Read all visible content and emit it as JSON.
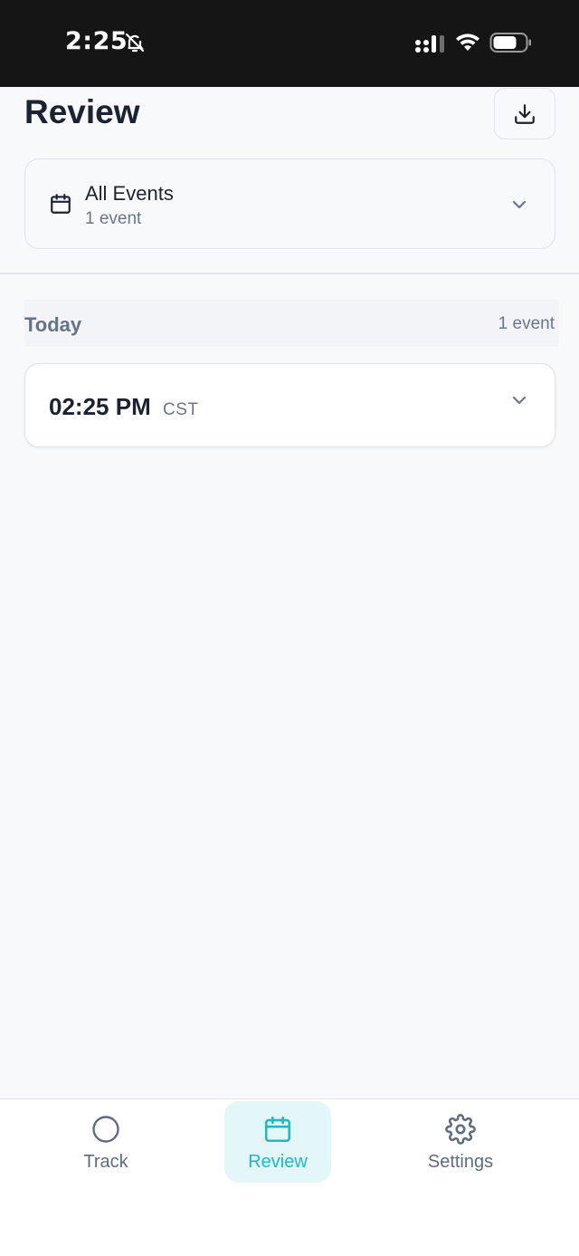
{
  "status_bar": {
    "time": "2:25",
    "icons": [
      "bell-slash-icon",
      "cellular-signal-icon",
      "wifi-icon",
      "battery-icon"
    ]
  },
  "header": {
    "title": "Review",
    "download_icon": "download-icon"
  },
  "filter": {
    "icon": "calendar-icon",
    "title": "All Events",
    "subtitle": "1 event",
    "chevron": "chevron-down-icon"
  },
  "section": {
    "title": "Today",
    "count": "1 event"
  },
  "events": [
    {
      "time": "02:25 PM",
      "timezone": "CST"
    }
  ],
  "nav": {
    "items": [
      {
        "label": "Track",
        "icon": "circle-icon",
        "active": false
      },
      {
        "label": "Review",
        "icon": "calendar-icon",
        "active": true
      },
      {
        "label": "Settings",
        "icon": "gear-icon",
        "active": false
      }
    ]
  },
  "colors": {
    "accent": "#1fb8c4",
    "accent_bg": "#e3f6f8",
    "text_primary": "#1c2230",
    "text_muted": "#6b7688",
    "border": "#dfe3ea",
    "background": "#f8f9fb",
    "status_bar": "#151515"
  }
}
